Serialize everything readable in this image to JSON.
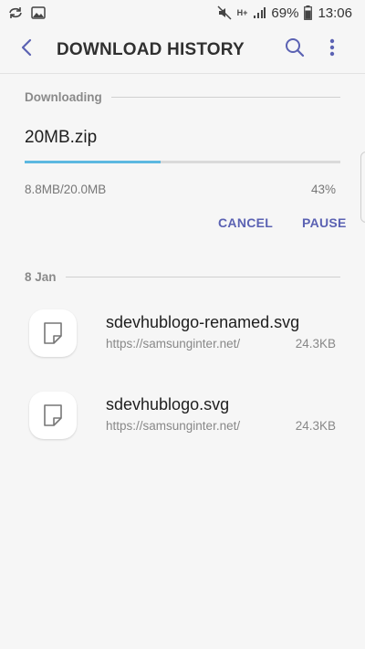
{
  "status_bar": {
    "battery_text": "69%",
    "time": "13:06",
    "network": "H+"
  },
  "header": {
    "title": "DOWNLOAD HISTORY",
    "back_icon": "back-arrow-icon",
    "search_icon": "search-icon",
    "more_icon": "more-vert-icon"
  },
  "downloading": {
    "section_label": "Downloading",
    "filename": "20MB.zip",
    "size_text": "8.8MB/20.0MB",
    "percent_text": "43%",
    "progress": 0.43,
    "cancel_label": "CANCEL",
    "pause_label": "PAUSE"
  },
  "history": {
    "section_label": "8 Jan",
    "items": [
      {
        "name": "sdevhublogo-renamed.svg",
        "url": "https://samsunginter.net/",
        "size": "24.3KB",
        "icon": "file-icon"
      },
      {
        "name": "sdevhublogo.svg",
        "url": "https://samsunginter.net/",
        "size": "24.3KB",
        "icon": "file-icon"
      }
    ]
  },
  "colors": {
    "accent": "#5b62b3",
    "progress": "#5cb8e0",
    "background": "#f6f6f6"
  }
}
